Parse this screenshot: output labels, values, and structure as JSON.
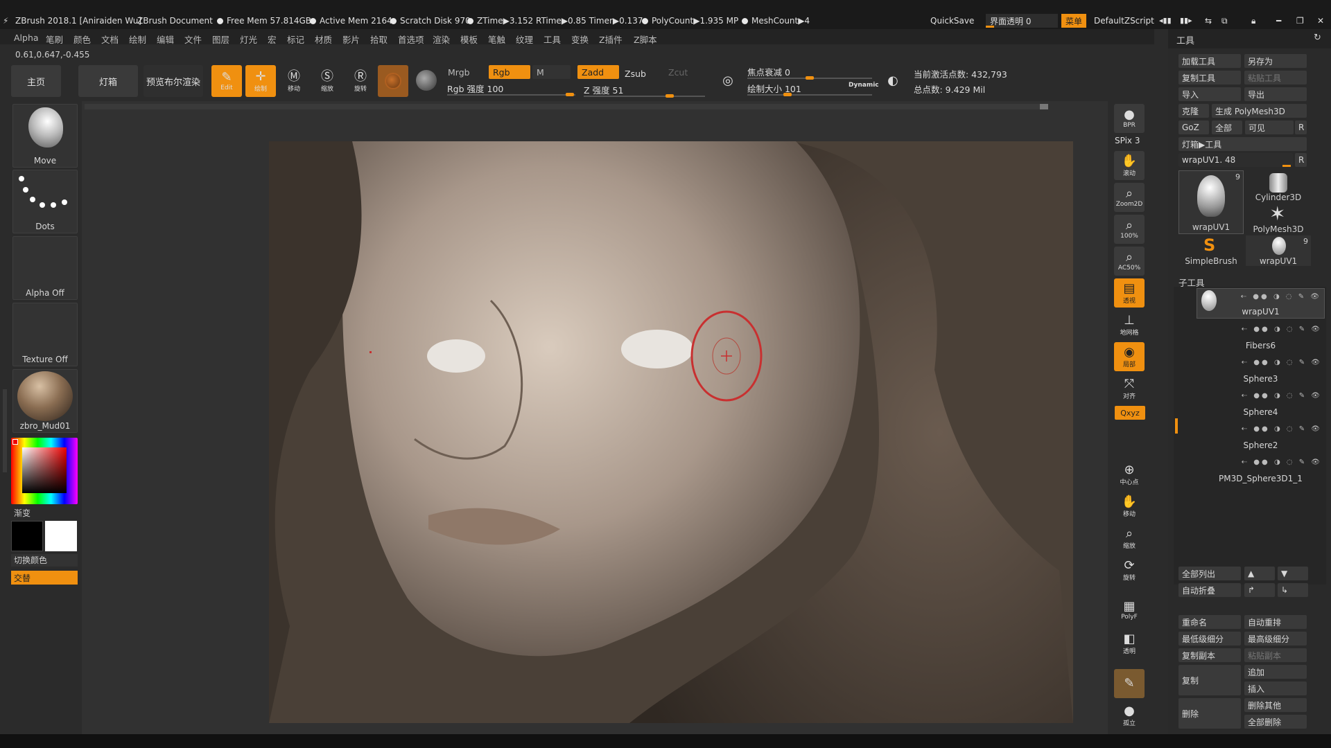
{
  "titlebar": {
    "app_title": "ZBrush 2018.1 [Aniraiden Wu]",
    "document": "ZBrush Document",
    "free_mem": "Free Mem 57.814GB",
    "active_mem": "Active Mem 2164",
    "scratch_disk": "Scratch Disk 970",
    "ztime": "ZTime▶3.152 RTime▶0.85 Timer▶0.137",
    "polycount": "PolyCount▶1.935 MP",
    "meshcount": "MeshCount▶4",
    "quicksave": "QuickSave",
    "transparency": "界面透明 0",
    "menu_button": "菜单",
    "default_script": "DefaultZScript"
  },
  "menubar": {
    "items": [
      "Alpha",
      "笔刷",
      "颜色",
      "文档",
      "绘制",
      "编辑",
      "文件",
      "图层",
      "灯光",
      "宏",
      "标记",
      "材质",
      "影片",
      "拾取",
      "首选项",
      "渲染",
      "模板",
      "笔触",
      "纹理",
      "工具",
      "变换",
      "Z插件",
      "Z脚本"
    ]
  },
  "coords": "0.61,0.647,-0.455",
  "toolbar": {
    "home": "主页",
    "lightbox": "灯箱",
    "preview_render": "预览布尔渲染",
    "edit": "Edit",
    "draw": "绘制",
    "move": "移动",
    "scale": "缩放",
    "rotate": "旋转",
    "mrgb": "Mrgb",
    "rgb": "Rgb",
    "m": "M",
    "zadd": "Zadd",
    "zsub": "Zsub",
    "zcut": "Zcut",
    "rgb_intensity": "Rgb 强度 100",
    "z_intensity": "Z 强度 51",
    "focal_shift": "焦点衰减 0",
    "draw_size": "绘制大小 101",
    "dynamic": "Dynamic",
    "active_points": "当前激活点数: 432,793",
    "total_points": "总点数: 9.429 Mil"
  },
  "leftshelf": {
    "brush": "Move",
    "stroke": "Dots",
    "alpha": "Alpha Off",
    "texture": "Texture Off",
    "material": "zbro_Mud01",
    "gradient": "渐变",
    "switch_color": "切换颜色",
    "alternate": "交替"
  },
  "rstrip": {
    "bpr": "BPR",
    "spix": "SPix 3",
    "scroll": "滚动",
    "zoom2d": "Zoom2D",
    "actual": "100%",
    "ac50": "AC50%",
    "persp": "透视",
    "floor": "地网格",
    "local": "局部",
    "frame": "对齐",
    "xyz": "Qxyz",
    "center": "中心点",
    "move": "移动",
    "scale": "缩放",
    "rotate": "旋转",
    "polyf": "PolyF",
    "transp": "透明",
    "solo": "孤立"
  },
  "rpanel": {
    "title": "工具",
    "load": "加载工具",
    "save_as": "另存为",
    "copy_tool": "复制工具",
    "paste_tool": "粘贴工具",
    "import": "导入",
    "export": "导出",
    "clone": "克隆",
    "make_polymesh": "生成 PolyMesh3D",
    "goz": "GoZ",
    "all": "全部",
    "visible": "可见",
    "r": "R",
    "lightbox_tool": "灯箱▶工具",
    "current_tool": "wrapUV1. 48",
    "thumbs": [
      {
        "name": "wrapUV1",
        "count": "9"
      },
      {
        "name": "Cylinder3D",
        "count": ""
      },
      {
        "name": "PolyMesh3D",
        "count": ""
      },
      {
        "name": "SimpleBrush",
        "count": ""
      },
      {
        "name": "wrapUV1",
        "count": "9"
      }
    ],
    "subtool_header": "子工具",
    "subtools": [
      "wrapUV1",
      "Fibers6",
      "Sphere3",
      "Sphere4",
      "Sphere2",
      "PM3D_Sphere3D1_1"
    ],
    "list_all": "全部列出",
    "auto_collapse": "自动折叠",
    "rename": "重命名",
    "auto_reorder": "自动重排",
    "lowest_sub": "最低级细分",
    "highest_sub": "最高级细分",
    "duplicate": "复制副本",
    "paste_copy": "粘贴副本",
    "copy": "复制",
    "append": "追加",
    "insert": "插入",
    "delete": "删除",
    "delete_other": "删除其他",
    "delete_all": "全部删除"
  },
  "colors": {
    "accent": "#f09010",
    "brush_circle": "#c83030"
  }
}
